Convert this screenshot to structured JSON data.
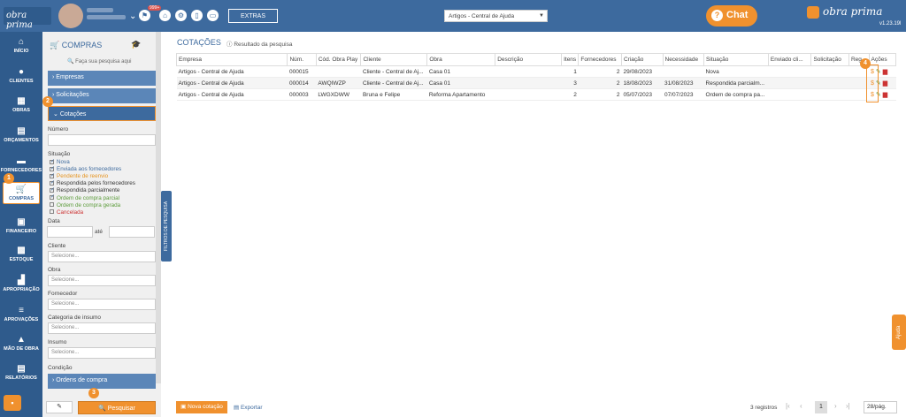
{
  "header": {
    "logo": "obra prima",
    "extras": "EXTRAS",
    "notification_count": "999+",
    "company_select": "Artigos - Central de Ajuda",
    "chat": "Chat",
    "brand": "obra prima",
    "version": "v1.23.19l"
  },
  "nav": [
    {
      "label": "INÍCIO",
      "icon": "home-icon"
    },
    {
      "label": "CLIENTES",
      "icon": "user-icon"
    },
    {
      "label": "OBRAS",
      "icon": "building-icon"
    },
    {
      "label": "ORÇAMENTOS",
      "icon": "document-icon"
    },
    {
      "label": "FORNECEDORES",
      "icon": "truck-icon"
    },
    {
      "label": "COMPRAS",
      "icon": "cart-icon"
    },
    {
      "label": "FINANCEIRO",
      "icon": "money-icon"
    },
    {
      "label": "ESTOQUE",
      "icon": "boxes-icon"
    },
    {
      "label": "APROPRIAÇÃO",
      "icon": "stamp-icon"
    },
    {
      "label": "APROVAÇÕES",
      "icon": "approval-icon"
    },
    {
      "label": "MÃO DE OBRA",
      "icon": "worker-icon"
    },
    {
      "label": "RELATÓRIOS",
      "icon": "report-icon"
    }
  ],
  "filter": {
    "title": "COMPRAS",
    "hint": "Faça sua pesquisa aqui",
    "sections": {
      "empresas": "Empresas",
      "solicitacoes": "Solicitações",
      "cotacoes": "Cotações",
      "ordens": "Ordens de compra"
    },
    "numero_label": "Número",
    "situacao_label": "Situação",
    "situacoes": [
      {
        "label": "Nova",
        "checked": true,
        "color": "#3d6a9e"
      },
      {
        "label": "Enviada aos fornecedores",
        "checked": true,
        "color": "#3d6a9e"
      },
      {
        "label": "Pendente de reenvio",
        "checked": true,
        "color": "#e69522"
      },
      {
        "label": "Respondida pelos fornecedores",
        "checked": true,
        "color": "#333333"
      },
      {
        "label": "Respondida parcialmente",
        "checked": true,
        "color": "#333333"
      },
      {
        "label": "Ordem de compra parcial",
        "checked": true,
        "color": "#5b9b3a"
      },
      {
        "label": "Ordem de compra gerada",
        "checked": false,
        "color": "#5b9b3a"
      },
      {
        "label": "Cancelada",
        "checked": false,
        "color": "#cc3333"
      }
    ],
    "data_label": "Data",
    "ate": "até",
    "cliente_label": "Cliente",
    "obra_label": "Obra",
    "fornecedor_label": "Fornecedor",
    "categoria_label": "Categoria de insumo",
    "insumo_label": "Insumo",
    "condicao_label": "Condição",
    "select_placeholder": "Selecione...",
    "search_button": "Pesquisar",
    "side_tab": "FILTROS DE PESQUISA"
  },
  "callouts": [
    "1",
    "2",
    "3",
    "4"
  ],
  "main": {
    "title": "COTAÇÕES",
    "subtitle": "Resultado da pesquisa",
    "columns": [
      "Empresa",
      "Núm.",
      "Cód. Obra Play",
      "Cliente",
      "Obra",
      "Descrição",
      "Itens",
      "Fornecedores",
      "Criação",
      "Necessidade",
      "Situação",
      "Enviado cli...",
      "Solicitação",
      "Reg...",
      "Ações"
    ],
    "rows": [
      [
        "Artigos - Central de Ajuda",
        "000015",
        "",
        "Cliente - Central de Aj...",
        "Casa 01",
        "",
        "1",
        "2",
        "29/08/2023",
        "",
        "Nova",
        "",
        "",
        ""
      ],
      [
        "Artigos - Central de Ajuda",
        "000014",
        "AWQIWZP",
        "Cliente - Central de Aj...",
        "Casa 01",
        "",
        "3",
        "2",
        "18/08/2023",
        "31/08/2023",
        "Respondida parcialm...",
        "",
        "",
        ""
      ],
      [
        "Artigos - Central de Ajuda",
        "000003",
        "LWGXDWW",
        "Bruna e Felipe",
        "Reforma Apartamento",
        "",
        "2",
        "2",
        "05/07/2023",
        "07/07/2023",
        "Ordem de compra pa...",
        "",
        "",
        ""
      ]
    ]
  },
  "footer": {
    "new_button": "Nova cotação",
    "export": "Exportar",
    "records": "3 registros",
    "page": "1",
    "per_page": "28/pág."
  },
  "help_tab": "Ajuda"
}
